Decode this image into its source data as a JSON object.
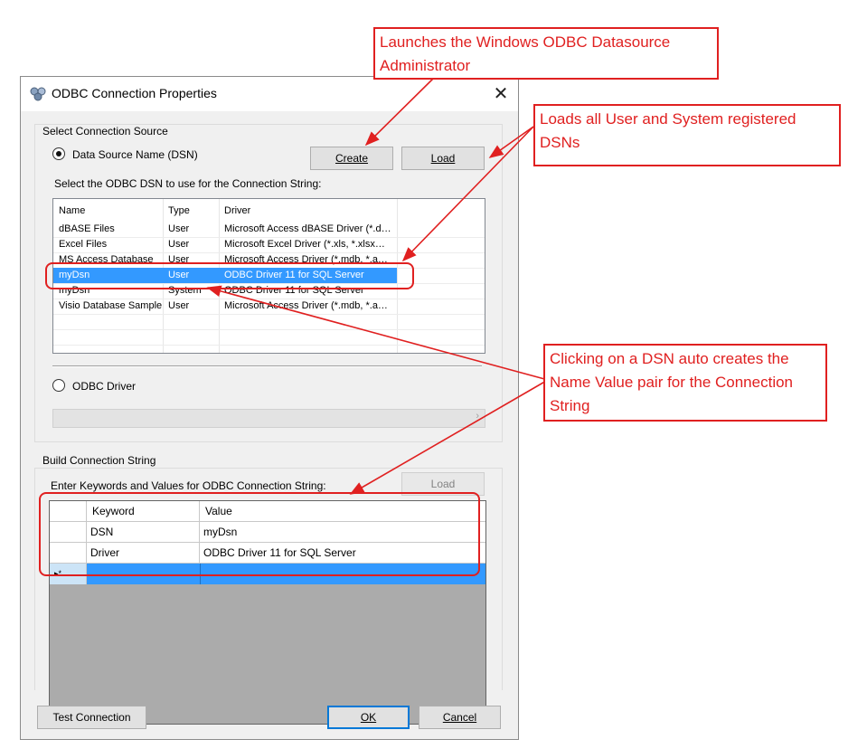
{
  "window": {
    "title": "ODBC Connection Properties",
    "close_glyph": "✕"
  },
  "source": {
    "group_label": "Select Connection Source",
    "dsn_radio_label": "Data Source Name (DSN)",
    "create_button": "Create",
    "load_button": "Load",
    "list_label": "Select the ODBC DSN to use for the Connection String:",
    "columns": [
      "Name",
      "Type",
      "Driver"
    ],
    "rows": [
      {
        "name": "dBASE Files",
        "type": "User",
        "driver": "Microsoft Access dBASE Driver (*.d…"
      },
      {
        "name": "Excel Files",
        "type": "User",
        "driver": "Microsoft Excel Driver (*.xls, *.xlsx…"
      },
      {
        "name": "MS Access Database",
        "type": "User",
        "driver": "Microsoft Access Driver (*.mdb, *.a…"
      },
      {
        "name": "myDsn",
        "type": "User",
        "driver": "ODBC Driver 11 for SQL Server"
      },
      {
        "name": "myDsn",
        "type": "System",
        "driver": "ODBC Driver 11 for SQL Server"
      },
      {
        "name": "Visio Database Samples",
        "type": "User",
        "driver": "Microsoft Access Driver (*.mdb, *.a…"
      }
    ],
    "selected_row": 3,
    "driver_radio_label": "ODBC Driver",
    "driver_select_value": ""
  },
  "build": {
    "group_label": "Build Connection String",
    "grid_label": "Enter Keywords and Values for ODBC Connection String:",
    "load_button": "Load",
    "columns": [
      "Keyword",
      "Value"
    ],
    "rows": [
      {
        "keyword": "DSN",
        "value": "myDsn"
      },
      {
        "keyword": "Driver",
        "value": "ODBC Driver 11 for SQL Server"
      }
    ],
    "new_row_marker": "▸*"
  },
  "footer": {
    "test_button": "Test Connection",
    "ok_button": "OK",
    "cancel_button": "Cancel"
  },
  "annotations": [
    {
      "text": "Launches the Windows ODBC Datasource Administrator"
    },
    {
      "text": "Loads all User and System registered DSNs"
    },
    {
      "text": "Clicking on a DSN auto creates the Name Value pair for the Connection String"
    }
  ],
  "colors": {
    "annotation": "#e02020",
    "selection": "#3399ff",
    "accent": "#0078d7"
  }
}
